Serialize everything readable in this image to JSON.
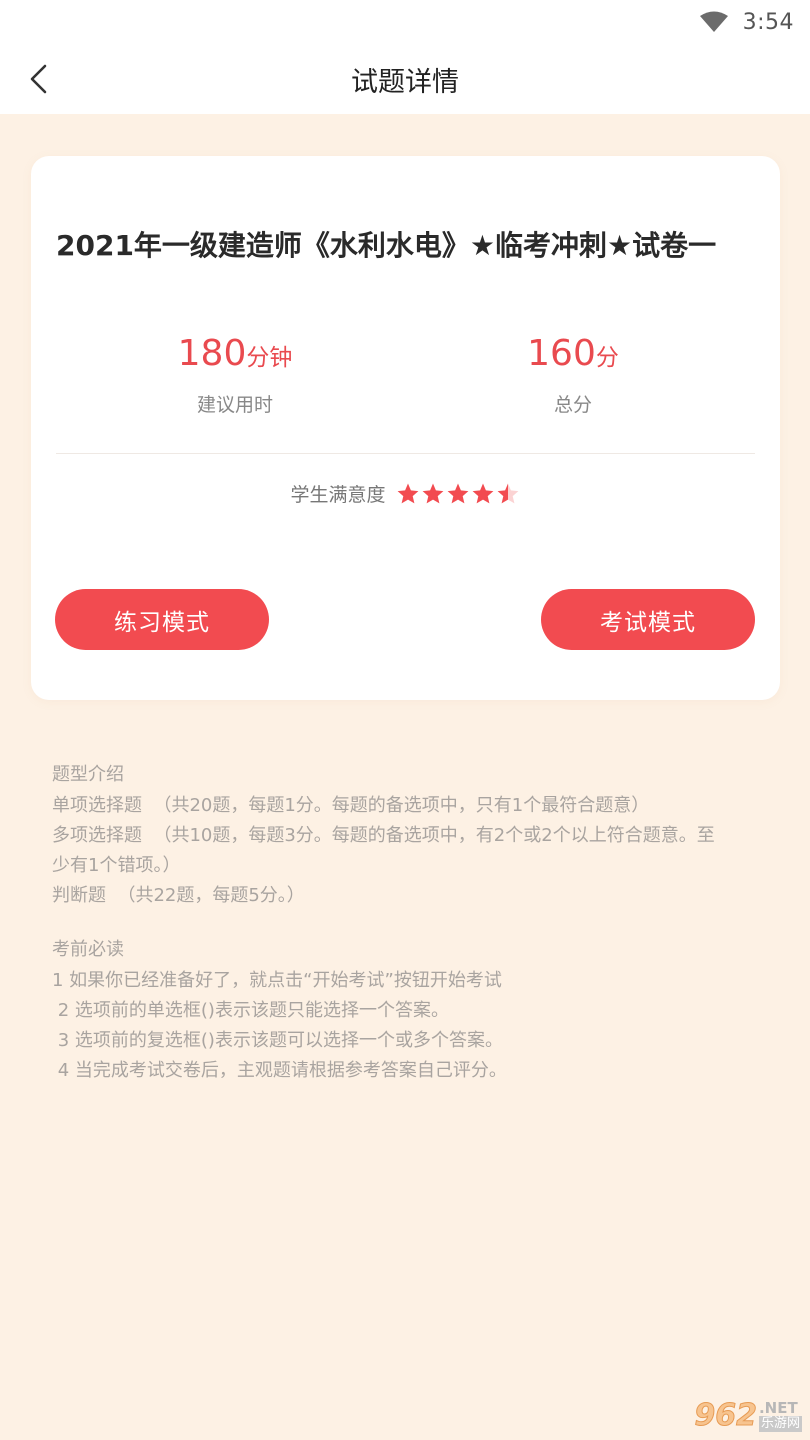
{
  "status_bar": {
    "time": "3:54",
    "icons": [
      "wifi-icon"
    ]
  },
  "nav": {
    "title": "试题详情",
    "back_icon": "chevron-left-icon"
  },
  "paper": {
    "title": "2021年一级建造师《水利水电》★临考冲刺★试卷一",
    "time_value": "180",
    "time_unit": "分钟",
    "time_label": "建议用时",
    "score_value": "160",
    "score_unit": "分",
    "score_label": "总分",
    "satisfaction_label": "学生满意度",
    "satisfaction_rating": 4.5,
    "satisfaction_max": 5,
    "practice_button": "练习模式",
    "exam_button": "考试模式"
  },
  "question_types": {
    "title": "题型介绍",
    "lines": [
      "单项选择题  （共20题，每题1分。每题的备选项中，只有1个最符合题意）",
      "多项选择题  （共10题，每题3分。每题的备选项中，有2个或2个以上符合题意。至",
      "少有1个错项。）",
      "判断题  （共22题，每题5分。）"
    ]
  },
  "exam_notes": {
    "title": "考前必读",
    "lines": [
      "1 如果你已经准备好了，就点击“开始考试”按钮开始考试",
      " 2 选项前的单选框()表示该题只能选择一个答案。",
      " 3 选项前的复选框()表示该题可以选择一个或多个答案。",
      " 4 当完成考试交卷后，主观题请根据参考答案自己评分。"
    ]
  },
  "watermark": {
    "number": "962",
    "net": ".NET",
    "site": "乐游网"
  },
  "colors": {
    "accent": "#f24b50",
    "accent_text": "#e94a4f",
    "page_bg": "#fdf1e4",
    "card_bg": "#ffffff",
    "star_empty": "#fbd3d3"
  }
}
